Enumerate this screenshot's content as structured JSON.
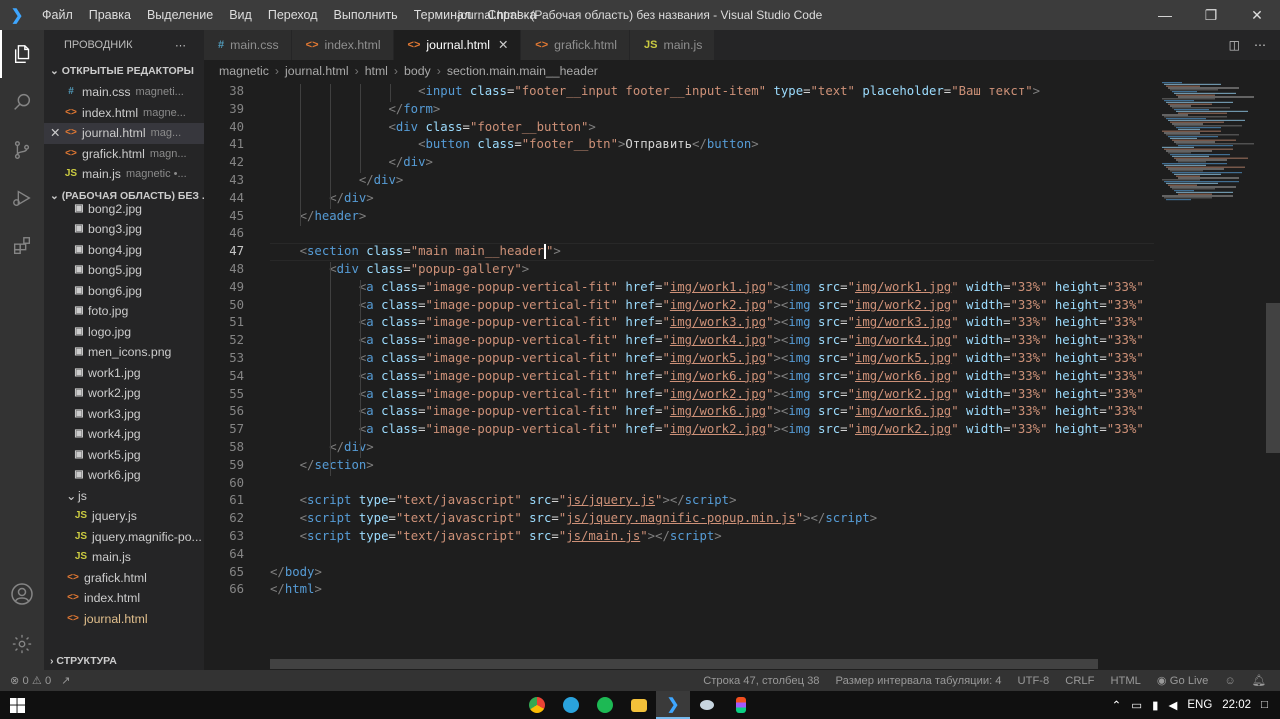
{
  "titlebar": {
    "menu": [
      "Файл",
      "Правка",
      "Выделение",
      "Вид",
      "Переход",
      "Выполнить",
      "Терминал",
      "Справка"
    ],
    "title": "journal.html - (Рабочая область) без названия - Visual Studio Code"
  },
  "sidebar": {
    "header": "ПРОВОДНИК",
    "open_editors_label": "ОТКРЫТЫЕ РЕДАКТОРЫ",
    "open_editors": [
      {
        "icon": "#",
        "type": "css",
        "name": "main.css",
        "desc": "magneti..."
      },
      {
        "icon": "<>",
        "type": "html",
        "name": "index.html",
        "desc": "magne..."
      },
      {
        "icon": "<>",
        "type": "html",
        "name": "journal.html",
        "desc": "mag..."
      },
      {
        "icon": "<>",
        "type": "html",
        "name": "grafick.html",
        "desc": "magn..."
      },
      {
        "icon": "JS",
        "type": "js",
        "name": "main.js",
        "desc": "magnetic •..."
      }
    ],
    "workspace_label": "(РАБОЧАЯ ОБЛАСТЬ) БЕЗ ...",
    "files": [
      "bong2.jpg",
      "bong3.jpg",
      "bong4.jpg",
      "bong5.jpg",
      "bong6.jpg",
      "foto.jpg",
      "logo.jpg",
      "men_icons.png",
      "work1.jpg",
      "work2.jpg",
      "work3.jpg",
      "work4.jpg",
      "work5.jpg",
      "work6.jpg"
    ],
    "js_folder": "js",
    "js_files": [
      "jquery.js",
      "jquery.magnific-po...",
      "main.js"
    ],
    "root_files": [
      "grafick.html",
      "index.html",
      "journal.html"
    ],
    "outline_label": "СТРУКТУРА"
  },
  "tabs": [
    {
      "icon": "#",
      "type": "css",
      "label": "main.css"
    },
    {
      "icon": "<>",
      "type": "html",
      "label": "index.html"
    },
    {
      "icon": "<>",
      "type": "html",
      "label": "journal.html",
      "active": true
    },
    {
      "icon": "<>",
      "type": "html",
      "label": "grafick.html"
    },
    {
      "icon": "JS",
      "type": "js",
      "label": "main.js"
    }
  ],
  "breadcrumb": [
    "magnetic",
    "journal.html",
    "html",
    "body",
    "section.main.main__header"
  ],
  "editor": {
    "current_line": 47,
    "lines": [
      38,
      39,
      40,
      41,
      42,
      43,
      44,
      45,
      46,
      47,
      48,
      49,
      50,
      51,
      52,
      53,
      54,
      55,
      56,
      57,
      58,
      59,
      60,
      61,
      62,
      63,
      64,
      65,
      66
    ],
    "placeholder_text": "Ваш текст",
    "button_text": "Отправить",
    "gallery_images": [
      {
        "href": "img/work1.jpg"
      },
      {
        "href": "img/work2.jpg"
      },
      {
        "href": "img/work3.jpg"
      },
      {
        "href": "img/work4.jpg"
      },
      {
        "href": "img/work5.jpg"
      },
      {
        "href": "img/work6.jpg"
      },
      {
        "href": "img/work2.jpg"
      },
      {
        "href": "img/work6.jpg"
      },
      {
        "href": "img/work2.jpg"
      }
    ],
    "scripts": [
      "js/jquery.js",
      "js/jquery.magnific-popup.min.js",
      "js/main.js"
    ]
  },
  "status": {
    "errors": "0",
    "warnings": "0",
    "position": "Строка 47, столбец 38",
    "tab_size": "Размер интервала табуляции: 4",
    "encoding": "UTF-8",
    "eol": "CRLF",
    "language": "HTML",
    "go_live": "Go Live"
  },
  "taskbar": {
    "lang": "ENG",
    "time": "22:02"
  }
}
